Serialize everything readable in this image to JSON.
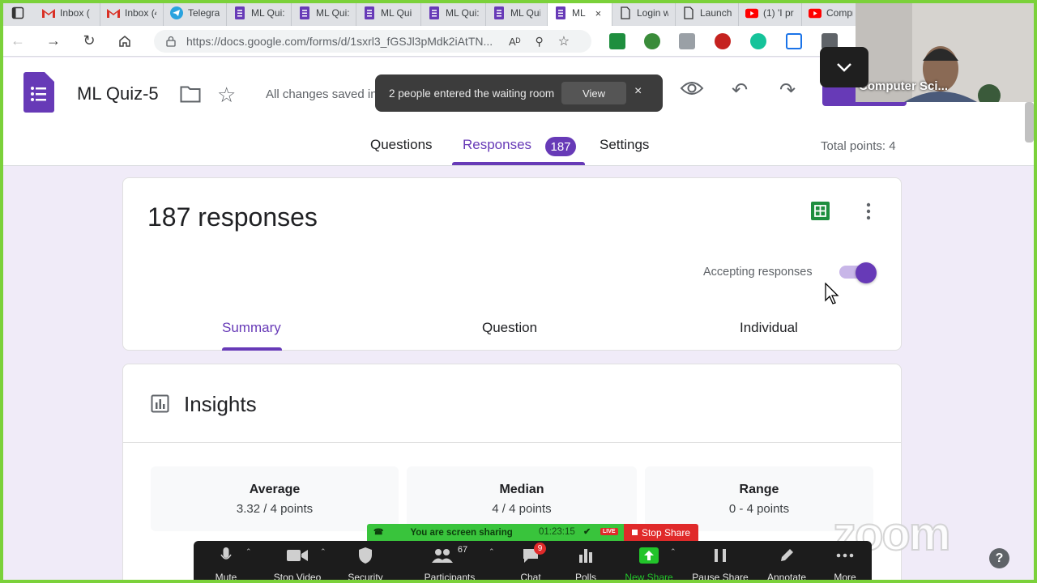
{
  "browser": {
    "tabs": [
      {
        "title": "Inbox (",
        "icon": "gmail-icon"
      },
      {
        "title": "Inbox (4",
        "icon": "gmail-icon"
      },
      {
        "title": "Telegrar",
        "icon": "telegram-icon"
      },
      {
        "title": "ML Qui:",
        "icon": "forms-icon"
      },
      {
        "title": "ML Qui:",
        "icon": "forms-icon"
      },
      {
        "title": "ML Qui",
        "icon": "forms-icon"
      },
      {
        "title": "ML Qui:",
        "icon": "forms-icon"
      },
      {
        "title": "ML Qui",
        "icon": "forms-icon"
      },
      {
        "title": "ML",
        "icon": "forms-icon",
        "active": true
      },
      {
        "title": "Login w",
        "icon": "doc-icon"
      },
      {
        "title": "Launch",
        "icon": "doc-icon"
      },
      {
        "title": "(1) 'I pr",
        "icon": "youtube-icon"
      },
      {
        "title": "Compr",
        "icon": "youtube-icon"
      }
    ],
    "close_tab": "×",
    "url": "https://docs.google.com/forms/d/1sxrl3_fGSJl3pMdk2iAtTN..."
  },
  "form_header": {
    "title": "ML Quiz-5",
    "save_status": "All changes saved in",
    "tabs": {
      "questions": "Questions",
      "responses": "Responses",
      "settings": "Settings"
    },
    "responses_badge": "187",
    "total_points": "Total points: 4"
  },
  "toast": {
    "message": "2 people entered the waiting room",
    "view_label": "View",
    "close": "×"
  },
  "responses_card": {
    "count_title": "187 responses",
    "accepting_label": "Accepting responses",
    "accepting": true,
    "subtabs": {
      "summary": "Summary",
      "question": "Question",
      "individual": "Individual"
    }
  },
  "insights": {
    "title": "Insights",
    "stats": [
      {
        "label": "Average",
        "value": "3.32 / 4 points"
      },
      {
        "label": "Median",
        "value": "4 / 4 points"
      },
      {
        "label": "Range",
        "value": "0 - 4 points"
      }
    ]
  },
  "webcam": {
    "name": "Computer Sci..."
  },
  "zoom": {
    "sharing_text": "You are screen sharing",
    "timer": "01:23:15",
    "live": "LIVE",
    "stop_share": "Stop Share",
    "participants_count": "67",
    "chat_badge": "9",
    "buttons": {
      "mute": "Mute",
      "stop_video": "Stop Video",
      "security": "Security",
      "participants": "Participants",
      "chat": "Chat",
      "polls": "Polls",
      "new_share": "New Share",
      "pause_share": "Pause Share",
      "annotate": "Annotate",
      "more": "More"
    },
    "logo": "zoom",
    "help": "?"
  },
  "colors": {
    "forms_purple": "#673ab7",
    "share_green": "#39c43c",
    "stop_red": "#e02a2a",
    "sheets_green": "#1e8e3e"
  }
}
